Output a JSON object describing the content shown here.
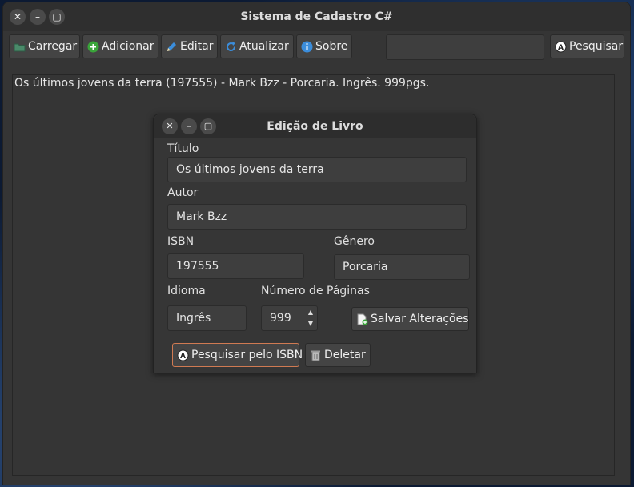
{
  "window": {
    "title": "Sistema de Cadastro C#",
    "close_glyph": "✕",
    "minimize_glyph": "–",
    "maximize_glyph": "▢"
  },
  "toolbar": {
    "load_label": "Carregar",
    "add_label": "Adicionar",
    "edit_label": "Editar",
    "refresh_label": "Atualizar",
    "about_label": "Sobre",
    "search_value": "",
    "search_label": "Pesquisar"
  },
  "list": {
    "items": [
      "Os últimos jovens da terra (197555) - Mark Bzz - Porcaria. Ingrês. 999pgs."
    ]
  },
  "dialog": {
    "title": "Edição de Livro",
    "title_label": "Título",
    "title_value": "Os últimos jovens da terra",
    "author_label": "Autor",
    "author_value": "Mark Bzz",
    "isbn_label": "ISBN",
    "isbn_value": "197555",
    "genre_label": "Gênero",
    "genre_value": "Porcaria",
    "language_label": "Idioma",
    "language_value": "Ingrês",
    "pages_label": "Número de Páginas",
    "pages_value": "999",
    "save_label": "Salvar Alterações",
    "search_isbn_label": "Pesquisar pelo ISBN",
    "delete_label": "Deletar"
  },
  "icons": {
    "load": "folder-icon",
    "add": "plus-circle-icon",
    "edit": "pencil-icon",
    "refresh": "refresh-icon",
    "about": "info-icon",
    "search": "search-a-icon",
    "save": "document-add-icon",
    "delete": "trash-icon"
  },
  "colors": {
    "accent_green": "#3aa53a",
    "accent_blue": "#3b8ddb",
    "focus_border": "#d07a52"
  }
}
